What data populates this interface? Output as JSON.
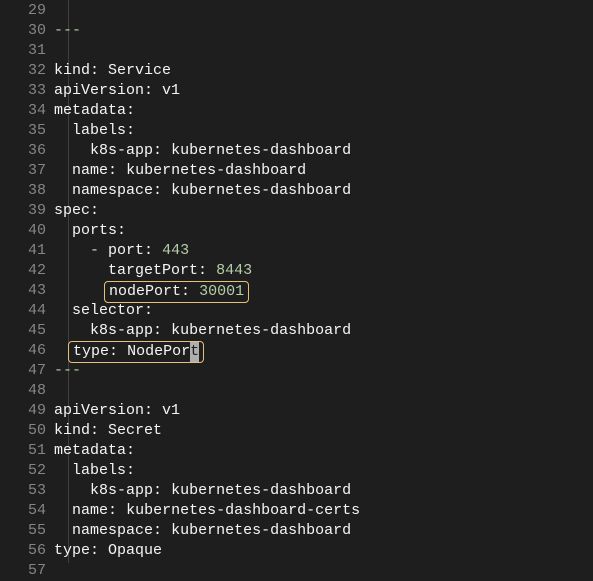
{
  "editor": {
    "lines": [
      {
        "num": "29",
        "plain": ""
      },
      {
        "num": "30",
        "sep": "---",
        "plain": ""
      },
      {
        "num": "31",
        "plain": ""
      },
      {
        "num": "32",
        "kv": {
          "indent": "",
          "key": "kind",
          "val": "Service"
        }
      },
      {
        "num": "33",
        "kv": {
          "indent": "",
          "key": "apiVersion",
          "val": "v1"
        }
      },
      {
        "num": "34",
        "kv": {
          "indent": "",
          "key": "metadata",
          "val": ""
        }
      },
      {
        "num": "35",
        "kv": {
          "indent": "  ",
          "key": "labels",
          "val": ""
        }
      },
      {
        "num": "36",
        "kv": {
          "indent": "    ",
          "key": "k8s-app",
          "val": "kubernetes-dashboard"
        }
      },
      {
        "num": "37",
        "kv": {
          "indent": "  ",
          "key": "name",
          "val": "kubernetes-dashboard"
        }
      },
      {
        "num": "38",
        "kv": {
          "indent": "  ",
          "key": "namespace",
          "val": "kubernetes-dashboard"
        }
      },
      {
        "num": "39",
        "kv": {
          "indent": "",
          "key": "spec",
          "val": ""
        }
      },
      {
        "num": "40",
        "kv": {
          "indent": "  ",
          "key": "ports",
          "val": ""
        }
      },
      {
        "num": "41",
        "kv": {
          "indent": "    - ",
          "key": "port",
          "val": "443",
          "numval": true
        }
      },
      {
        "num": "42",
        "kv": {
          "indent": "      ",
          "key": "targetPort",
          "val": "8443",
          "numval": true
        }
      },
      {
        "num": "43",
        "hl_box": true,
        "kv": {
          "indent": "      ",
          "key": "nodePort",
          "val": "30001",
          "numval": true
        }
      },
      {
        "num": "44",
        "kv": {
          "indent": "  ",
          "key": "selector",
          "val": ""
        }
      },
      {
        "num": "45",
        "kv": {
          "indent": "    ",
          "key": "k8s-app",
          "val": "kubernetes-dashboard"
        }
      },
      {
        "num": "46",
        "hl_box": true,
        "cursor_tail": "t",
        "kv": {
          "indent": "  ",
          "key": "type",
          "val": "NodePor"
        }
      },
      {
        "num": "47",
        "sep": "---",
        "plain": ""
      },
      {
        "num": "48",
        "plain": ""
      },
      {
        "num": "49",
        "kv": {
          "indent": "",
          "key": "apiVersion",
          "val": "v1"
        }
      },
      {
        "num": "50",
        "kv": {
          "indent": "",
          "key": "kind",
          "val": "Secret"
        }
      },
      {
        "num": "51",
        "kv": {
          "indent": "",
          "key": "metadata",
          "val": ""
        }
      },
      {
        "num": "52",
        "kv": {
          "indent": "  ",
          "key": "labels",
          "val": ""
        }
      },
      {
        "num": "53",
        "kv": {
          "indent": "    ",
          "key": "k8s-app",
          "val": "kubernetes-dashboard"
        }
      },
      {
        "num": "54",
        "kv": {
          "indent": "  ",
          "key": "name",
          "val": "kubernetes-dashboard-certs"
        }
      },
      {
        "num": "55",
        "kv": {
          "indent": "  ",
          "key": "namespace",
          "val": "kubernetes-dashboard"
        }
      },
      {
        "num": "56",
        "kv": {
          "indent": "",
          "key": "type",
          "val": "Opaque"
        }
      },
      {
        "num": "57",
        "plain": ""
      }
    ]
  }
}
